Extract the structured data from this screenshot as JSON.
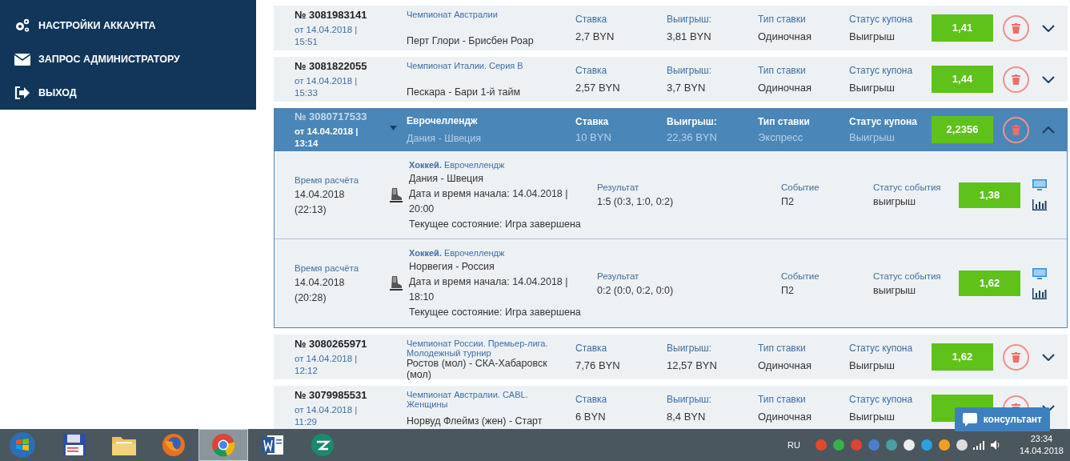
{
  "sidebar": {
    "items": [
      {
        "label": "НАСТРОЙКИ АККАУНТА"
      },
      {
        "label": "ЗАПРОС АДМИНИСТРАТОРУ"
      },
      {
        "label": "ВЫХОД"
      }
    ]
  },
  "coupons": [
    {
      "number": "№ 3081983141",
      "date": "от 14.04.2018 |",
      "time": "15:51",
      "league": "Чемпионат Австралии",
      "match": "Перт Глори - Брисбен Роар",
      "stake_label": "Ставка",
      "stake": "2,7 BYN",
      "win_label": "Выигрыш:",
      "win": "3,81 BYN",
      "type_label": "Тип ставки",
      "type": "Одиночная",
      "status_label": "Статус купона",
      "status": "Выигрыш",
      "odds": "1,41",
      "expanded": false
    },
    {
      "number": "№ 3081822055",
      "date": "от 14.04.2018 |",
      "time": "15:33",
      "league": "Чемпионат Италии. Серия B",
      "match": "Пескара - Бари 1-й тайм",
      "stake_label": "Ставка",
      "stake": "2,57 BYN",
      "win_label": "Выигрыш:",
      "win": "3,7 BYN",
      "type_label": "Тип ставки",
      "type": "Одиночная",
      "status_label": "Статус купона",
      "status": "Выигрыш",
      "odds": "1,44",
      "expanded": false
    },
    {
      "number": "№ 3080717533",
      "date": "от 14.04.2018 |",
      "time": "13:14",
      "league": "Еврочеллендж",
      "match": "Дания - Швеция",
      "stake_label": "Ставка",
      "stake": "10 BYN",
      "win_label": "Выигрыш:",
      "win": "22,36 BYN",
      "type_label": "Тип ставки",
      "type": "Экспресс",
      "status_label": "Статус купона",
      "status": "Выигрыш",
      "odds": "2,2356",
      "expanded": true,
      "events": [
        {
          "calc_label": "Время расчёта",
          "calc_date": "14.04.2018",
          "calc_time": "(22:13)",
          "sport": "**Хоккей.** Еврочеллендж",
          "match": "Дания - Швеция",
          "start": "Дата и время начала: 14.04.2018 |",
          "start_time": "20:00",
          "state": "Текущее состояние: Игра завершена",
          "result_label": "Результат",
          "result": "1:5 (0:3, 1:0, 0:2)",
          "event_label": "Событие",
          "event": "П2",
          "status_label": "Статус события",
          "status": "выигрыш",
          "odds": "1,38"
        },
        {
          "calc_label": "Время расчёта",
          "calc_date": "14.04.2018",
          "calc_time": "(20:28)",
          "sport": "**Хоккей.** Еврочеллендж",
          "match": "Норвегия - Россия",
          "start": "Дата и время начала: 14.04.2018 |",
          "start_time": "18:10",
          "state": "Текущее состояние: Игра завершена",
          "result_label": "Результат",
          "result": "0:2 (0:0, 0:2, 0:0)",
          "event_label": "Событие",
          "event": "П2",
          "status_label": "Статус события",
          "status": "выигрыш",
          "odds": "1,62"
        }
      ]
    },
    {
      "number": "№ 3080265971",
      "date": "от 14.04.2018 |",
      "time": "12:12",
      "league": "Чемпионат России. Премьер-лига. Молодежный турнир",
      "match": "Ростов (мол) - СКА-Хабаровск (мол)",
      "stake_label": "Ставка",
      "stake": "7,76 BYN",
      "win_label": "Выигрыш:",
      "win": "12,57 BYN",
      "type_label": "Тип ставки",
      "type": "Одиночная",
      "status_label": "Статус купона",
      "status": "Выигрыш",
      "odds": "1,62",
      "expanded": false
    },
    {
      "number": "№ 3079985531",
      "date": "от 14.04.2018 |",
      "time": "11:29",
      "league": "Чемпионат Австралии. CABL. Женщины",
      "match": "Норвуд Флеймз (жен) - Старт",
      "stake_label": "Ставка",
      "stake": "6 BYN",
      "win_label": "Выигрыш:",
      "win": "8,4 BYN",
      "type_label": "Тип ставки",
      "type": "Одиночная",
      "status_label": "Статус купона",
      "status": "Выигрыш",
      "expanded": false
    }
  ],
  "chat_button": {
    "label": "консультант"
  },
  "taskbar": {
    "apps": [
      {
        "kind": "disk",
        "selected": false
      },
      {
        "kind": "folder",
        "selected": false
      },
      {
        "kind": "firefox",
        "selected": false
      },
      {
        "kind": "chrome",
        "selected": true
      },
      {
        "kind": "word",
        "selected": false
      },
      {
        "kind": "green",
        "selected": false
      }
    ],
    "language": "RU",
    "time": "23:34",
    "date": "14.04.2018"
  }
}
